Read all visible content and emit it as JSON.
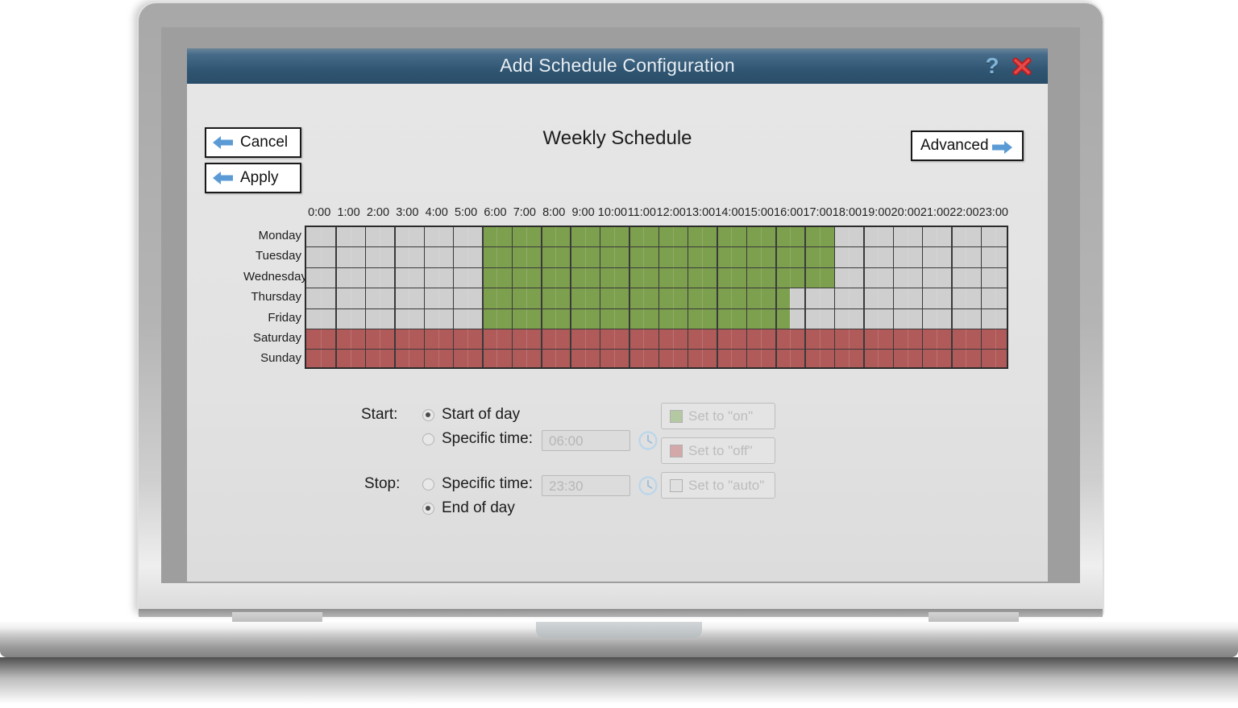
{
  "window": {
    "title": "Add Schedule Configuration",
    "help_icon": "question-mark-icon",
    "close_icon": "close-x-icon"
  },
  "toolbar": {
    "cancel_label": "Cancel",
    "apply_label": "Apply",
    "advanced_label": "Advanced"
  },
  "heading": "Weekly Schedule",
  "colors": {
    "on": "#7da04e",
    "off": "#b15a5a",
    "auto": "#cfcfcf",
    "titlebar": "#2f5572",
    "accent_blue": "#5b9bd5"
  },
  "schedule": {
    "hour_labels": [
      "0:00",
      "1:00",
      "2:00",
      "3:00",
      "4:00",
      "5:00",
      "6:00",
      "7:00",
      "8:00",
      "9:00",
      "10:00",
      "11:00",
      "12:00",
      "13:00",
      "14:00",
      "15:00",
      "16:00",
      "17:00",
      "18:00",
      "19:00",
      "20:00",
      "21:00",
      "22:00",
      "23:00"
    ],
    "days": [
      "Monday",
      "Tuesday",
      "Wednesday",
      "Thursday",
      "Friday",
      "Saturday",
      "Sunday"
    ],
    "rows": [
      {
        "day": "Monday",
        "segments": [
          {
            "start": 0.0,
            "end": 6.0,
            "state": "auto"
          },
          {
            "start": 6.0,
            "end": 18.0,
            "state": "on"
          },
          {
            "start": 18.0,
            "end": 24.0,
            "state": "auto"
          }
        ]
      },
      {
        "day": "Tuesday",
        "segments": [
          {
            "start": 0.0,
            "end": 6.0,
            "state": "auto"
          },
          {
            "start": 6.0,
            "end": 18.0,
            "state": "on"
          },
          {
            "start": 18.0,
            "end": 24.0,
            "state": "auto"
          }
        ]
      },
      {
        "day": "Wednesday",
        "segments": [
          {
            "start": 0.0,
            "end": 6.0,
            "state": "auto"
          },
          {
            "start": 6.0,
            "end": 18.0,
            "state": "on"
          },
          {
            "start": 18.0,
            "end": 24.0,
            "state": "auto"
          }
        ]
      },
      {
        "day": "Thursday",
        "segments": [
          {
            "start": 0.0,
            "end": 6.0,
            "state": "auto"
          },
          {
            "start": 6.0,
            "end": 16.5,
            "state": "on"
          },
          {
            "start": 16.5,
            "end": 24.0,
            "state": "auto"
          }
        ]
      },
      {
        "day": "Friday",
        "segments": [
          {
            "start": 0.0,
            "end": 6.0,
            "state": "auto"
          },
          {
            "start": 6.0,
            "end": 16.5,
            "state": "on"
          },
          {
            "start": 16.5,
            "end": 24.0,
            "state": "auto"
          }
        ]
      },
      {
        "day": "Saturday",
        "segments": [
          {
            "start": 0.0,
            "end": 24.0,
            "state": "off"
          }
        ]
      },
      {
        "day": "Sunday",
        "segments": [
          {
            "start": 0.0,
            "end": 24.0,
            "state": "off"
          }
        ]
      }
    ]
  },
  "options": {
    "start_label": "Start:",
    "stop_label": "Stop:",
    "start_of_day_label": "Start of day",
    "start_specific_label": "Specific time:",
    "stop_specific_label": "Specific time:",
    "end_of_day_label": "End of day",
    "start_time_value": "06:00",
    "stop_time_value": "23:30",
    "start_of_day_selected": true,
    "start_specific_selected": false,
    "stop_specific_selected": false,
    "end_of_day_selected": true,
    "set_on_label": "Set to \"on\"",
    "set_off_label": "Set to \"off\"",
    "set_auto_label": "Set to \"auto\""
  }
}
